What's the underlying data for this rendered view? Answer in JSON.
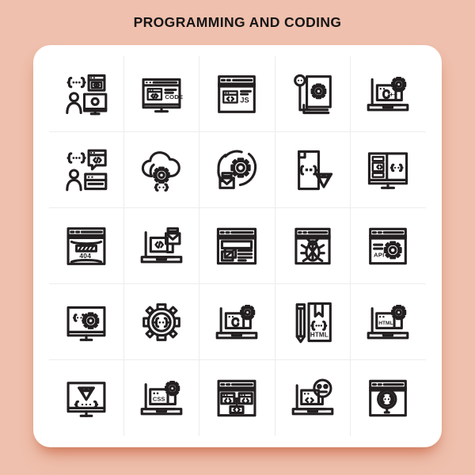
{
  "header": {
    "title": "PROGRAMMING AND CODING"
  },
  "theme": {
    "background_color": "#efc0ad",
    "card_color": "#ffffff",
    "icon_stroke_color": "#231f20",
    "divider_color": "#ededed"
  },
  "grid": {
    "columns": 5,
    "rows": 5,
    "total_icons": 25,
    "icons": [
      {
        "id": 1,
        "name": "developer-with-monitor-and-code-brackets",
        "label": ""
      },
      {
        "id": 2,
        "name": "monitor-code-editor",
        "label": "CODE"
      },
      {
        "id": 3,
        "name": "browser-javascript-window",
        "label": "JS"
      },
      {
        "id": 4,
        "name": "stacked-pages-settings-gear",
        "label": ""
      },
      {
        "id": 5,
        "name": "laptop-cplusplus-gear",
        "label": "C++"
      },
      {
        "id": 6,
        "name": "developer-chat-code-brackets",
        "label": ""
      },
      {
        "id": 7,
        "name": "cloud-computing-gear-code",
        "label": ""
      },
      {
        "id": 8,
        "name": "developer-gear-process",
        "label": ""
      },
      {
        "id": 9,
        "name": "document-code-diamond",
        "label": ""
      },
      {
        "id": 10,
        "name": "monitor-split-code-panels",
        "label": ""
      },
      {
        "id": 11,
        "name": "browser-404-error-page",
        "label": "404"
      },
      {
        "id": 12,
        "name": "laptop-developer-coding",
        "label": ""
      },
      {
        "id": 13,
        "name": "browser-web-layout-design",
        "label": ""
      },
      {
        "id": 14,
        "name": "browser-bug-debugging",
        "label": ""
      },
      {
        "id": 15,
        "name": "browser-api-gear",
        "label": "API"
      },
      {
        "id": 16,
        "name": "monitor-code-gear-settings",
        "label": ""
      },
      {
        "id": 17,
        "name": "gear-code-brackets",
        "label": ""
      },
      {
        "id": 18,
        "name": "laptop-csharp-gear",
        "label": ""
      },
      {
        "id": 19,
        "name": "pencil-html-book",
        "label": "HTML"
      },
      {
        "id": 20,
        "name": "laptop-html-gear",
        "label": "HTML"
      },
      {
        "id": 21,
        "name": "monitor-diamond-code",
        "label": ""
      },
      {
        "id": 22,
        "name": "laptop-css-gear",
        "label": "CSS"
      },
      {
        "id": 23,
        "name": "browser-code-sitemap-tree",
        "label": ""
      },
      {
        "id": 24,
        "name": "laptop-code-neutral-face",
        "label": ""
      },
      {
        "id": 25,
        "name": "browser-code-search-magnifier",
        "label": ""
      }
    ],
    "icon_labels": {
      "code": "CODE",
      "js": "JS",
      "cpp": "C++",
      "error404": "404",
      "api": "API",
      "html": "HTML",
      "css": "CSS"
    }
  }
}
